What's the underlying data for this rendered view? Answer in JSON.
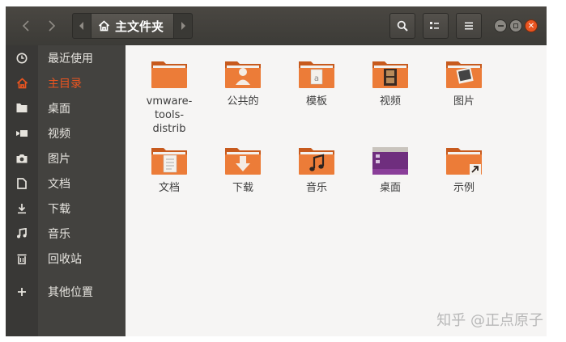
{
  "window": {
    "path_current": "主文件夹",
    "buttons": {
      "back": "back-icon",
      "forward": "forward-icon",
      "search": "search-icon",
      "view": "list-view-icon",
      "menu": "hamburger-menu-icon"
    }
  },
  "sidebar": {
    "items": [
      {
        "label": "最近使用",
        "icon": "clock-icon",
        "active": false
      },
      {
        "label": "主目录",
        "icon": "home-icon",
        "active": true
      },
      {
        "label": "桌面",
        "icon": "folder-icon",
        "active": false
      },
      {
        "label": "视频",
        "icon": "video-icon",
        "active": false
      },
      {
        "label": "图片",
        "icon": "camera-icon",
        "active": false
      },
      {
        "label": "文档",
        "icon": "document-icon",
        "active": false
      },
      {
        "label": "下载",
        "icon": "download-icon",
        "active": false
      },
      {
        "label": "音乐",
        "icon": "music-icon",
        "active": false
      },
      {
        "label": "回收站",
        "icon": "trash-icon",
        "active": false
      },
      {
        "label": "其他位置",
        "icon": "plus-icon",
        "active": false
      }
    ]
  },
  "files": [
    {
      "label": "vmware-\ntools-\ndistrib",
      "icon": "folder-icon"
    },
    {
      "label": "公共的",
      "icon": "folder-public-icon"
    },
    {
      "label": "模板",
      "icon": "folder-templates-icon"
    },
    {
      "label": "视频",
      "icon": "folder-videos-icon"
    },
    {
      "label": "图片",
      "icon": "folder-pictures-icon"
    },
    {
      "label": "文档",
      "icon": "folder-documents-icon"
    },
    {
      "label": "下载",
      "icon": "folder-download-icon"
    },
    {
      "label": "音乐",
      "icon": "folder-music-icon"
    },
    {
      "label": "桌面",
      "icon": "desktop-folder-icon"
    },
    {
      "label": "示例",
      "icon": "folder-examples-icon"
    }
  ],
  "watermark": "知乎 @正点原子",
  "colors": {
    "accent": "#e95420",
    "header": "#3c3b37",
    "sidebar": "#43423f",
    "folder": "#e8732e"
  }
}
